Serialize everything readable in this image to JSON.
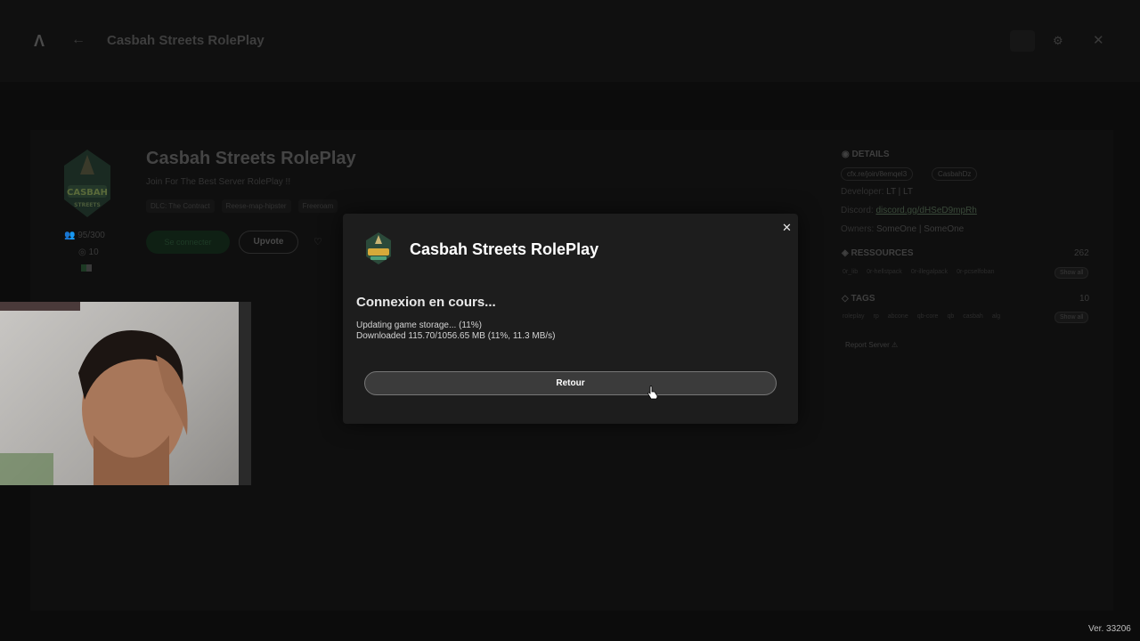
{
  "topbar": {
    "logo_glyph": "Λ",
    "back_glyph": "←",
    "title": "Casbah Streets RolePlay",
    "gear_glyph": "⚙",
    "close_glyph": "✕"
  },
  "server": {
    "title": "Casbah Streets RolePlay",
    "subtitle": "Join For The Best Server RolePlay !!",
    "tags": [
      "DLC: The Contract",
      "Reese-map-hipster",
      "Freeroam"
    ],
    "players": "95/300",
    "ping": "10",
    "connect_label": "Se connecter",
    "upvote_label": "Upvote",
    "heart_glyph": "♡",
    "logo_text_top": "CASBAH",
    "logo_text_bottom": "STREETS"
  },
  "sidebar": {
    "details_heading": "DETAILS",
    "join_chip": "cfx.re/join/8emqel3",
    "owner_chip": "CasbahDz",
    "developer_label": "Developer:",
    "developer_value": "LT | LT",
    "discord_label": "Discord:",
    "discord_value": "discord.gg/dHSeD9mpRh",
    "owners_label": "Owners:",
    "owners_value": "SomeOne | SomeOne",
    "resources_heading": "RESSOURCES",
    "resources_count": "262",
    "resources": [
      "0r_lib",
      "0r-hellstpack",
      "0r-illegalpack",
      "0r-pcselfoban"
    ],
    "tags_heading": "TAGS",
    "tags_count": "10",
    "tags": [
      "roleplay",
      "rp",
      "abcone",
      "qb-core",
      "qb",
      "casbah",
      "alg"
    ],
    "show_all": "Show all",
    "report": "Report Server"
  },
  "modal": {
    "title": "Casbah Streets RolePlay",
    "status": "Connexion en cours...",
    "line1": "Updating game storage... (11%)",
    "line2": "Downloaded 115.70/1056.65 MB (11%, 11.3 MB/s)",
    "progress_percent": 11,
    "button": "Retour",
    "close_glyph": "✕"
  },
  "footer": {
    "version": "Ver. 33206"
  }
}
